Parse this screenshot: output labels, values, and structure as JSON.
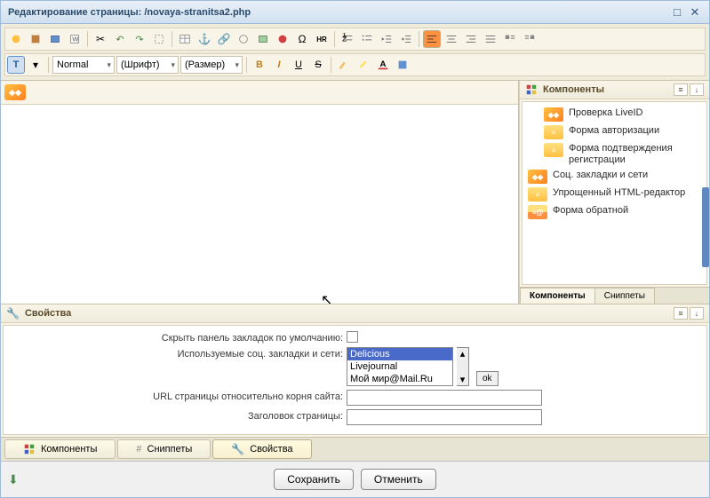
{
  "title": "Редактирование страницы: /novaya-stranitsa2.php",
  "toolbar": {
    "format_select": "Normal",
    "font_select": "(Шрифт)",
    "size_select": "(Размер)"
  },
  "components_panel": {
    "title": "Компоненты",
    "items": [
      {
        "label": "Проверка LiveID",
        "icon": "orange",
        "indent": true
      },
      {
        "label": "Форма авторизации",
        "icon": "yellow",
        "indent": true
      },
      {
        "label": "Форма подтверждения регистрации",
        "icon": "yellow",
        "indent": true
      },
      {
        "label": "Соц. закладки и сети",
        "icon": "orange",
        "indent": false
      },
      {
        "label": "Упрощенный HTML-редактор",
        "icon": "yellow",
        "indent": false
      },
      {
        "label": "Форма обратной",
        "icon": "mixed",
        "indent": false
      }
    ],
    "tabs": {
      "components": "Компоненты",
      "snippets": "Сниппеты"
    }
  },
  "properties_panel": {
    "title": "Свойства",
    "hide_bookmarks_label": "Скрыть панель закладок по умолчанию:",
    "used_networks_label": "Используемые соц. закладки и сети:",
    "network_options": [
      "Delicious",
      "Livejournal",
      "Мой мир@Mail.Ru"
    ],
    "url_label": "URL страницы относительно корня сайта:",
    "page_title_label": "Заголовок страницы:",
    "ok_btn": "ok"
  },
  "bottom_tabs": {
    "components": "Компоненты",
    "snippets": "Сниппеты",
    "properties": "Свойства"
  },
  "footer": {
    "save": "Сохранить",
    "cancel": "Отменить"
  }
}
